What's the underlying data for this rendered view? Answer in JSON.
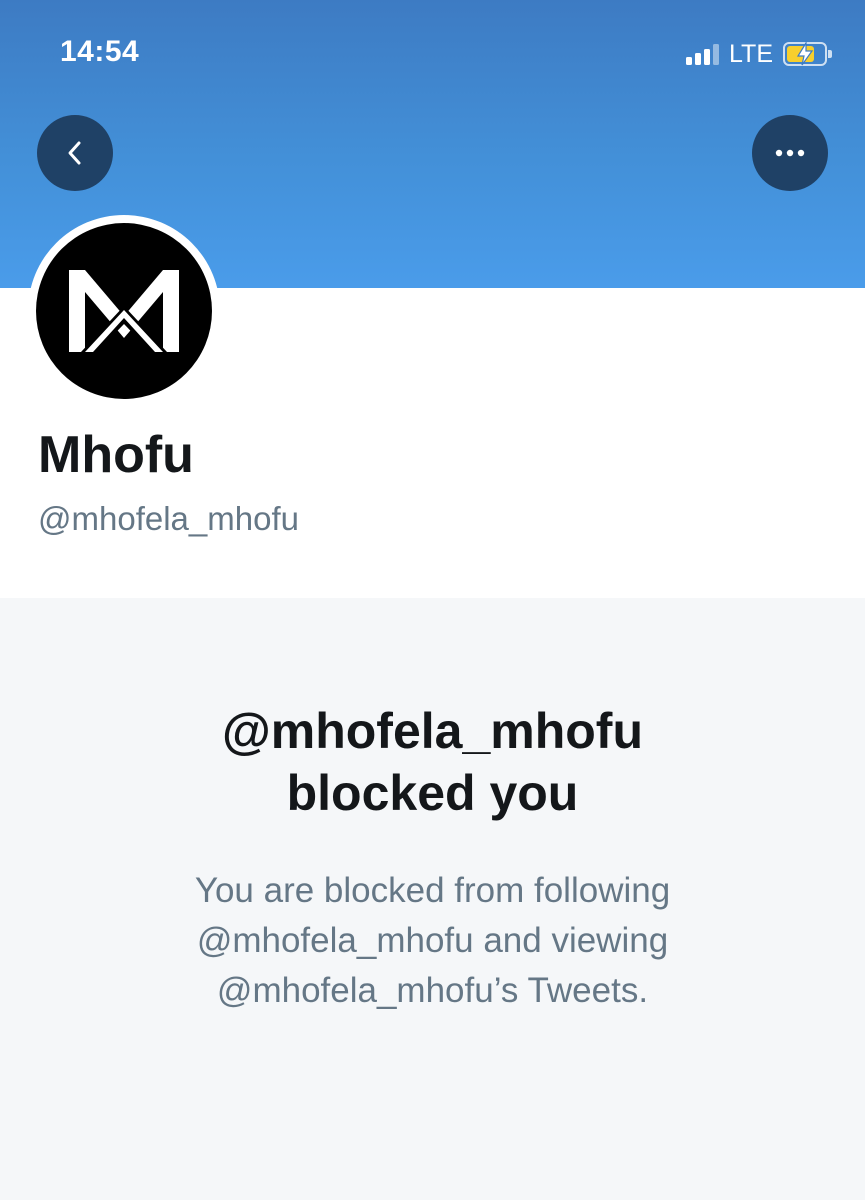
{
  "status_bar": {
    "time": "14:54",
    "network": "LTE",
    "signal_bars": 4,
    "signal_strength": 3,
    "battery_level": 0.75,
    "battery_charging": true
  },
  "header": {
    "back_icon": "chevron-left-icon",
    "more_icon": "more-horizontal-icon"
  },
  "profile": {
    "display_name": "Mhofu",
    "handle": "@mhofela_mhofu",
    "avatar_logo": "M"
  },
  "blocked": {
    "title_line1": "@mhofela_mhofu",
    "title_line2": "blocked you",
    "description_line1": "You are blocked from following",
    "description_line2": "@mhofela_mhofu and viewing",
    "description_line3": "@mhofela_mhofu’s Tweets."
  },
  "colors": {
    "banner_top": "#3d7bc3",
    "banner_bottom": "#4a9cea",
    "header_button": "#1f4166",
    "primary_text": "#14171a",
    "secondary_text": "#657786",
    "battery_fill": "#f7cf2d"
  }
}
